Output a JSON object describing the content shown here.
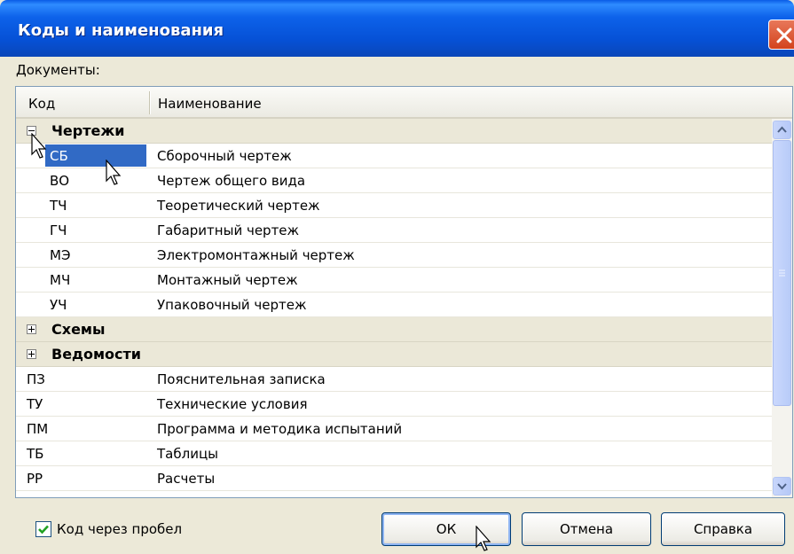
{
  "window": {
    "title": "Коды и наименования"
  },
  "documents_label": "Документы:",
  "columns": {
    "code": "Код",
    "name": "Наименование"
  },
  "groups": [
    {
      "name": "Чертежи",
      "expanded": true,
      "items": [
        {
          "code": "СБ",
          "name": "Сборочный чертеж",
          "selected": true
        },
        {
          "code": "ВО",
          "name": "Чертеж общего вида"
        },
        {
          "code": "ТЧ",
          "name": "Теоретический чертеж"
        },
        {
          "code": "ГЧ",
          "name": "Габаритный чертеж"
        },
        {
          "code": "МЭ",
          "name": "Электромонтажный чертеж"
        },
        {
          "code": "МЧ",
          "name": "Монтажный чертеж"
        },
        {
          "code": "УЧ",
          "name": "Упаковочный чертеж"
        }
      ]
    },
    {
      "name": "Схемы",
      "expanded": false
    },
    {
      "name": "Ведомости",
      "expanded": false
    }
  ],
  "documents": [
    {
      "code": "ПЗ",
      "name": "Пояснительная записка"
    },
    {
      "code": "ТУ",
      "name": "Технические условия"
    },
    {
      "code": "ПМ",
      "name": "Программа и методика испытаний"
    },
    {
      "code": "ТБ",
      "name": "Таблицы"
    },
    {
      "code": "РР",
      "name": "Расчеты"
    }
  ],
  "options": {
    "code_with_space_label": "Код через пробел",
    "code_with_space_checked": true
  },
  "buttons": {
    "ok": "ОК",
    "cancel": "Отмена",
    "help": "Справка"
  },
  "colors": {
    "selection": "#316ac5",
    "titlebar": "#0651d6",
    "close": "#d3431d",
    "check": "#21a121"
  }
}
